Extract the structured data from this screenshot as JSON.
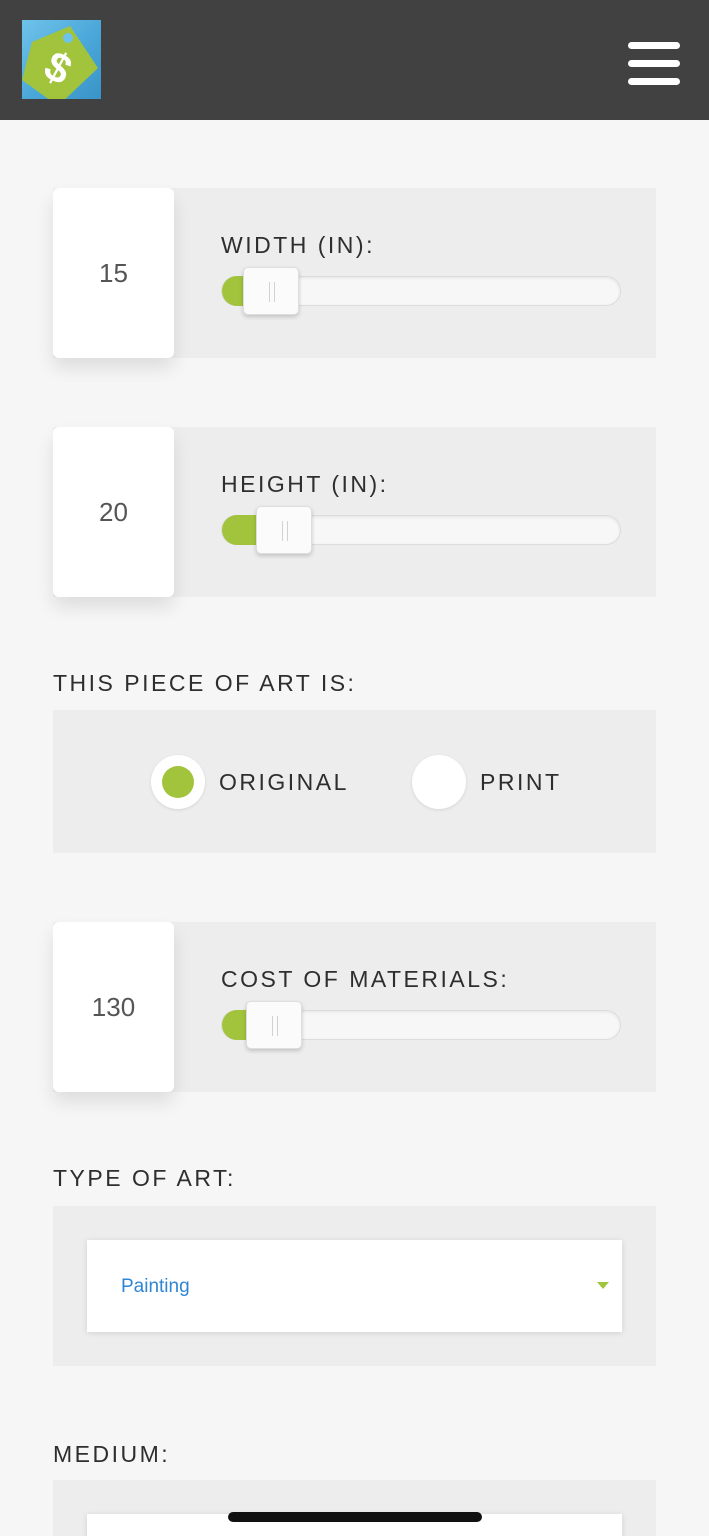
{
  "header": {
    "logo_icon": "price-tag-dollar-icon",
    "menu_icon": "hamburger-menu-icon"
  },
  "width": {
    "label": "WIDTH (IN):",
    "value": "15",
    "slider_fraction": 0.06
  },
  "height": {
    "label": "HEIGHT (IN):",
    "value": "20",
    "slider_fraction": 0.1
  },
  "art_type": {
    "label": "THIS PIECE OF ART IS:",
    "options": [
      {
        "label": "ORIGINAL",
        "selected": true
      },
      {
        "label": "PRINT",
        "selected": false
      }
    ]
  },
  "materials": {
    "label": "COST OF MATERIALS:",
    "value": "130",
    "slider_fraction": 0.07
  },
  "type_of_art": {
    "label": "TYPE OF ART:",
    "selected": "Painting"
  },
  "medium": {
    "label": "MEDIUM:"
  },
  "colors": {
    "header": "#414141",
    "accent": "#a1c43c",
    "link": "#2f86d6",
    "panel": "#ededed"
  }
}
